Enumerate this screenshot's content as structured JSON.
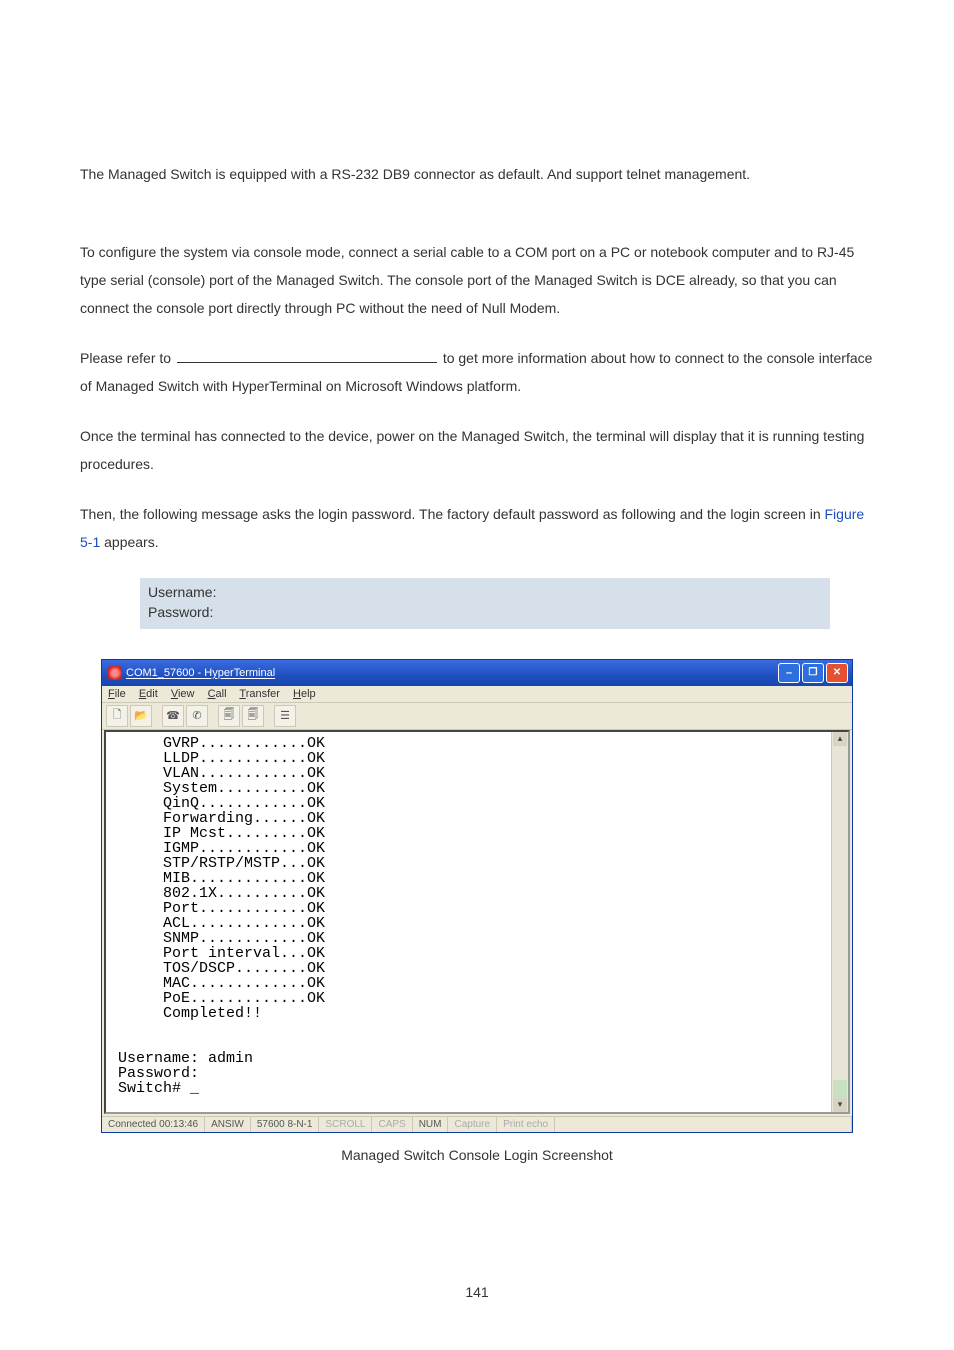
{
  "intro_para": "The Managed Switch is equipped with a RS-232 DB9 connector as default. And support telnet management.",
  "para2": "To configure the system via console mode, connect a serial cable to a COM port on a PC or notebook computer and to RJ-45 type serial (console) port of the Managed Switch. The console port of the Managed Switch is DCE already, so that you can connect the console port directly through PC without the need of Null Modem.",
  "para3a": "Please refer to ",
  "para3b": " to get more information about how to connect to the console interface of Managed Switch with HyperTerminal on Microsoft Windows platform.",
  "para4": "Once the terminal has connected to the device, power on the Managed Switch, the terminal will display that it is running testing procedures.",
  "para5a": "Then, the following message asks the login password. The factory default password as following and the login screen in ",
  "para5_figref": "Figure 5-1",
  "para5b": " appears.",
  "cred_user_label": "Username:",
  "cred_pass_label": "Password:",
  "ht": {
    "title": "COM1_57600 - HyperTerminal",
    "menu": [
      "File",
      "Edit",
      "View",
      "Call",
      "Transfer",
      "Help"
    ],
    "terminal_text": "     GVRP............OK\n     LLDP............OK\n     VLAN............OK\n     System..........OK\n     QinQ............OK\n     Forwarding......OK\n     IP Mcst.........OK\n     IGMP............OK\n     STP/RSTP/MSTP...OK\n     MIB.............OK\n     802.1X..........OK\n     Port............OK\n     ACL.............OK\n     SNMP............OK\n     Port interval...OK\n     TOS/DSCP........OK\n     MAC.............OK\n     PoE.............OK\n     Completed!!\n\n\nUsername: admin\nPassword:\nSwitch# _",
    "status": {
      "conn": "Connected 00:13:46",
      "emu": "ANSIW",
      "port": "57600 8-N-1",
      "scroll": "SCROLL",
      "caps": "CAPS",
      "num": "NUM",
      "capture": "Capture",
      "echo": "Print echo"
    }
  },
  "caption": "Managed Switch Console Login Screenshot",
  "page_number": "141"
}
